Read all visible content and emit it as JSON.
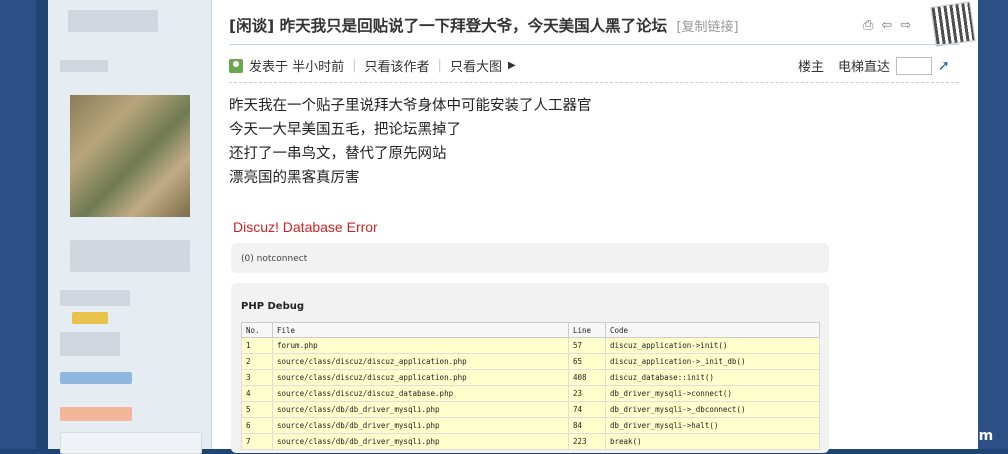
{
  "title": "[闲谈] 昨天我只是回贴说了一下拜登大爷，今天美国人黑了论坛",
  "copy_link": "[复制链接]",
  "meta": {
    "posted": "发表于 半小时前",
    "only_author": "只看该作者",
    "only_big_image": "只看大图",
    "floor": "楼主",
    "elevator": "电梯直达"
  },
  "post_lines": [
    "昨天我在一个贴子里说拜大爷身体中可能安装了人工器官",
    "今天一大早美国五毛，把论坛黑掉了",
    "还打了一串鸟文，替代了原先网站",
    "漂亮国的黑客真厉害"
  ],
  "error": {
    "title": "Discuz! Database Error",
    "message": "(0) notconnect",
    "debug_title": "PHP Debug",
    "columns": [
      "No.",
      "File",
      "Line",
      "Code"
    ],
    "rows": [
      [
        "1",
        "forum.php",
        "57",
        "discuz_application->init()"
      ],
      [
        "2",
        "source/class/discuz/discuz_application.php",
        "65",
        "discuz_application->_init_db()"
      ],
      [
        "3",
        "source/class/discuz/discuz_application.php",
        "408",
        "discuz_database::init()"
      ],
      [
        "4",
        "source/class/discuz/discuz_database.php",
        "23",
        "db_driver_mysqli->connect()"
      ],
      [
        "5",
        "source/class/db/db_driver_mysqli.php",
        "74",
        "db_driver_mysqli->_dbconnect()"
      ],
      [
        "6",
        "source/class/db/db_driver_mysqli.php",
        "84",
        "db_driver_mysqli->halt()"
      ],
      [
        "7",
        "source/class/db/db_driver_mysqli.php",
        "223",
        "break()"
      ]
    ]
  },
  "watermark": "talkfx.com"
}
